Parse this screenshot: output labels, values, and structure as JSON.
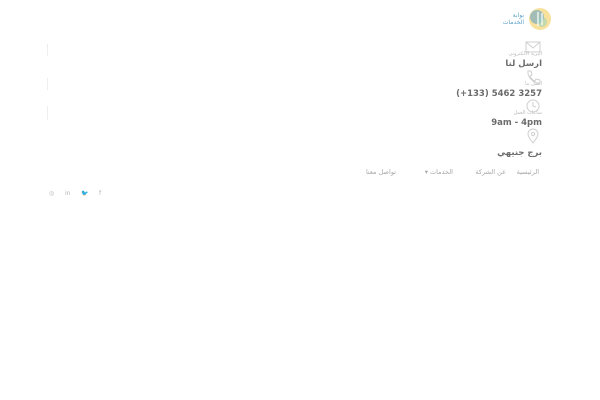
{
  "brand": {
    "name_line1": "بوابة",
    "name_line2": "الخدمات",
    "logo_icon": "logo-mark"
  },
  "contacts": {
    "mail": {
      "icon": "mail-icon",
      "caption": "البريد الالكتروني",
      "value": "ارسل لنا"
    },
    "phone": {
      "icon": "phone-icon",
      "caption": "اتصل بنا",
      "value": "3257 5462 (133+)"
    },
    "hours": {
      "icon": "clock-icon",
      "caption": "ساعات العمل",
      "value": "9am - 4pm"
    },
    "location": {
      "icon": "location-pin-icon",
      "caption": "",
      "value": "برج جنيهي"
    }
  },
  "nav": {
    "home": "الرئيسية",
    "about": "عن الشركة",
    "services": "الخدمات ▾",
    "contact": "تواصل معنا"
  },
  "social": {
    "facebook": "f",
    "twitter": "🐦",
    "linkedin": "in",
    "instagram": "◎"
  },
  "colors": {
    "accent_blue": "#5aa0c8",
    "accent_yellow": "#f2c94c",
    "text_gray": "#6b6b6b",
    "muted_gray": "#a8a8a8"
  }
}
